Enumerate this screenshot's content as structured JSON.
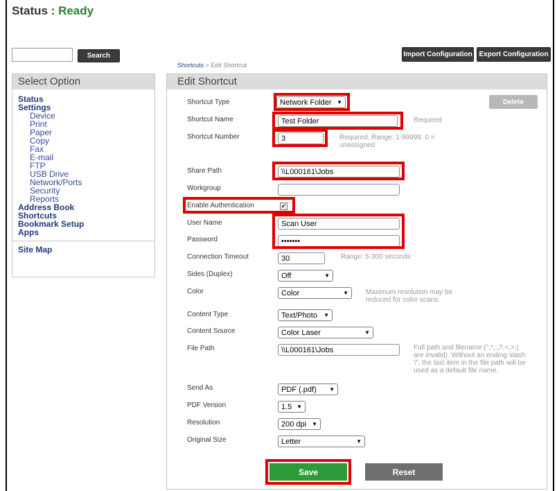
{
  "status": {
    "label": "Status : ",
    "value": "Ready"
  },
  "search": {
    "placeholder": "",
    "button": "Search"
  },
  "toolbar": {
    "import": "Import Configuration",
    "export": "Export Configuration"
  },
  "breadcrumb": {
    "parent": "Shortcuts",
    "separator": " > ",
    "current": "Edit Shortcut"
  },
  "sidebar": {
    "title": "Select Option",
    "status": "Status",
    "settings": "Settings",
    "settings_items": [
      "Device",
      "Print",
      "Paper",
      "Copy",
      "Fax",
      "E-mail",
      "FTP",
      "USB Drive",
      "Network/Ports",
      "Security",
      "Reports"
    ],
    "address_book": "Address Book",
    "shortcuts": "Shortcuts",
    "bookmark_setup": "Bookmark Setup",
    "apps": "Apps",
    "site_map": "Site Map"
  },
  "form": {
    "title": "Edit Shortcut",
    "delete": "Delete",
    "shortcut_type": {
      "label": "Shortcut Type",
      "value": "Network Folder"
    },
    "shortcut_name": {
      "label": "Shortcut Name",
      "value": "Test Folder",
      "hint": "Required"
    },
    "shortcut_number": {
      "label": "Shortcut Number",
      "value": "3",
      "hint1": "Required. Range: 1-99999. 0 =",
      "hint2": "unassigned"
    },
    "share_path": {
      "label": "Share Path",
      "value": "\\\\L000161\\Jobs"
    },
    "workgroup": {
      "label": "Workgroup",
      "value": ""
    },
    "enable_auth": {
      "label": "Enable Authentication",
      "checked": true,
      "mark": "✔"
    },
    "user_name": {
      "label": "User Name",
      "value": "Scan User"
    },
    "password": {
      "label": "Password",
      "value": "•••••••"
    },
    "connection_timeout": {
      "label": "Connection Timeout",
      "value": "30",
      "hint": "Range: 5-300 seconds"
    },
    "sides": {
      "label": "Sides (Duplex)",
      "value": "Off"
    },
    "color": {
      "label": "Color",
      "value": "Color",
      "hint1": "Maximum resolution may be",
      "hint2": "reduced for color scans."
    },
    "content_type": {
      "label": "Content Type",
      "value": "Text/Photo"
    },
    "content_source": {
      "label": "Content Source",
      "value": "Color Laser"
    },
    "file_path": {
      "label": "File Path",
      "value": "\\\\L000161\\Jobs",
      "hint1": "Full path and filename (\",*,:,?,<,>,|",
      "hint2": "are invalid). Without an ending slash",
      "hint3": "'/', the last item in the file path will be",
      "hint4": "used as a default file name."
    },
    "send_as": {
      "label": "Send As",
      "value": "PDF (.pdf)"
    },
    "pdf_version": {
      "label": "PDF Version",
      "value": "1.5"
    },
    "resolution": {
      "label": "Resolution",
      "value": "200 dpi"
    },
    "original_size": {
      "label": "Original Size",
      "value": "Letter"
    },
    "save": "Save",
    "reset": "Reset"
  },
  "colors": {
    "ready": "#2d7d32",
    "save": "#2d9a3a",
    "highlight": "#e00000"
  }
}
